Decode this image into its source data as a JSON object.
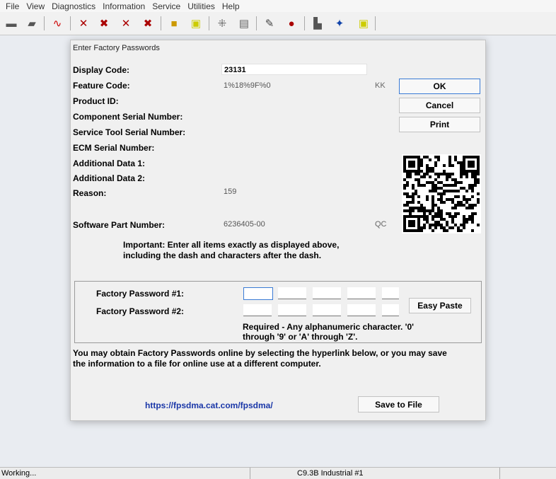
{
  "menu": [
    "File",
    "View",
    "Diagnostics",
    "Information",
    "Service",
    "Utilities",
    "Help"
  ],
  "toolbar_icons": [
    "print-icon",
    "printer-icon",
    "waveform-icon",
    "diagnostic-icon",
    "tools-icon",
    "flash-icon",
    "wrench-icon",
    "module-icon",
    "battery-icon",
    "tune-icon",
    "calibrate-icon",
    "report-icon",
    "log-icon",
    "ecm-icon",
    "config-icon",
    "password-icon"
  ],
  "dialog": {
    "title": "Enter Factory Passwords",
    "fields": {
      "display_code_label": "Display Code:",
      "display_code_value": "23131",
      "feature_code_label": "Feature Code:",
      "feature_code_value": "1%18%9F%0",
      "feature_code_indicator": "KK",
      "product_id_label": "Product ID:",
      "component_serial_label": "Component Serial Number:",
      "service_tool_serial_label": "Service Tool Serial Number:",
      "ecm_serial_label": "ECM Serial Number:",
      "additional_data_1_label": "Additional Data 1:",
      "additional_data_2_label": "Additional Data 2:",
      "reason_label": "Reason:",
      "reason_value": "159",
      "software_part_label": "Software Part Number:",
      "software_part_value": "6236405-00",
      "software_part_indicator": "QC"
    },
    "buttons": {
      "ok": "OK",
      "cancel": "Cancel",
      "print": "Print",
      "easy_paste": "Easy Paste",
      "save_to_file": "Save to File"
    },
    "important_line1": "Important: Enter all items exactly as displayed above,",
    "important_line2": "including the dash and characters after the dash.",
    "password1_label": "Factory Password #1:",
    "password2_label": "Factory Password #2:",
    "required_line1": "Required - Any alphanumeric character. '0'",
    "required_line2": "through '9' or 'A' through 'Z'.",
    "info_line1": "You may obtain Factory Passwords online by selecting the hyperlink below, or you may save",
    "info_line2": "the information to a file for online use at a different computer.",
    "link": "https://fpsdma.cat.com/fpsdma/"
  },
  "status": {
    "left": "Working...",
    "center": "C9.3B Industrial #1"
  }
}
